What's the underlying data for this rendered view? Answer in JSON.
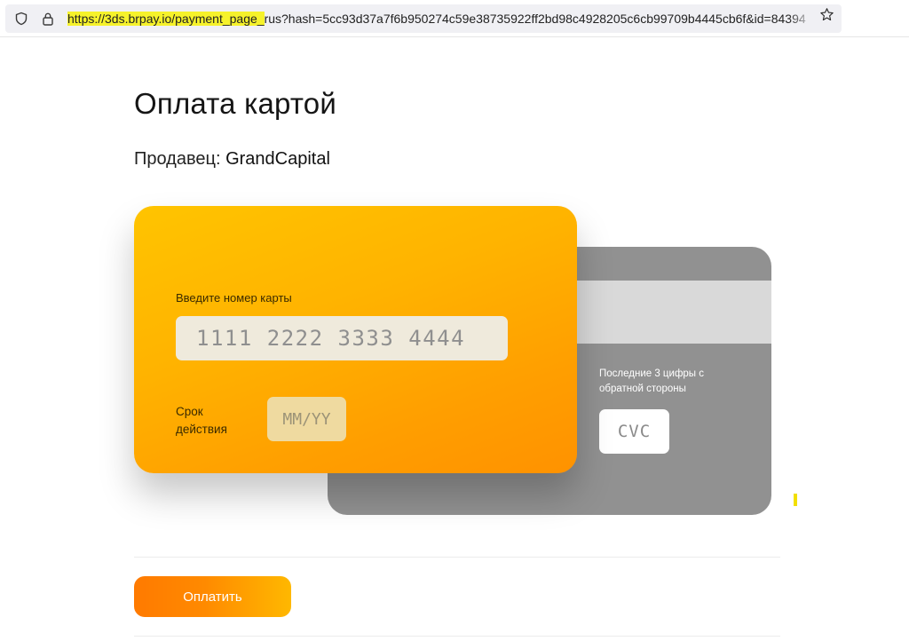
{
  "browser": {
    "url_highlighted": "https://3ds.brpay.io/payment_page_",
    "url_rest": "rus?hash=5cc93d37a7f6b950274c59e38735922ff2bd98c4928205c6cb99709b4445cb6f&id=84394"
  },
  "page": {
    "title": "Оплата картой",
    "seller_label": "Продавец:",
    "seller_name": "GrandCapital"
  },
  "card_front": {
    "number_label": "Введите номер карты",
    "number_placeholder": "1111 2222 3333 4444",
    "expiry_label": "Срок действия",
    "expiry_placeholder": "MM/YY"
  },
  "card_back": {
    "cvc_label": "Последние 3 цифры с обратной стороны",
    "cvc_placeholder": "CVC"
  },
  "actions": {
    "pay_label": "Оплатить"
  },
  "colors": {
    "card_front_start": "#ffc400",
    "card_front_end": "#ff9200",
    "card_back": "#919191",
    "pay_button_start": "#ff7a00",
    "pay_button_end": "#ffb800"
  }
}
